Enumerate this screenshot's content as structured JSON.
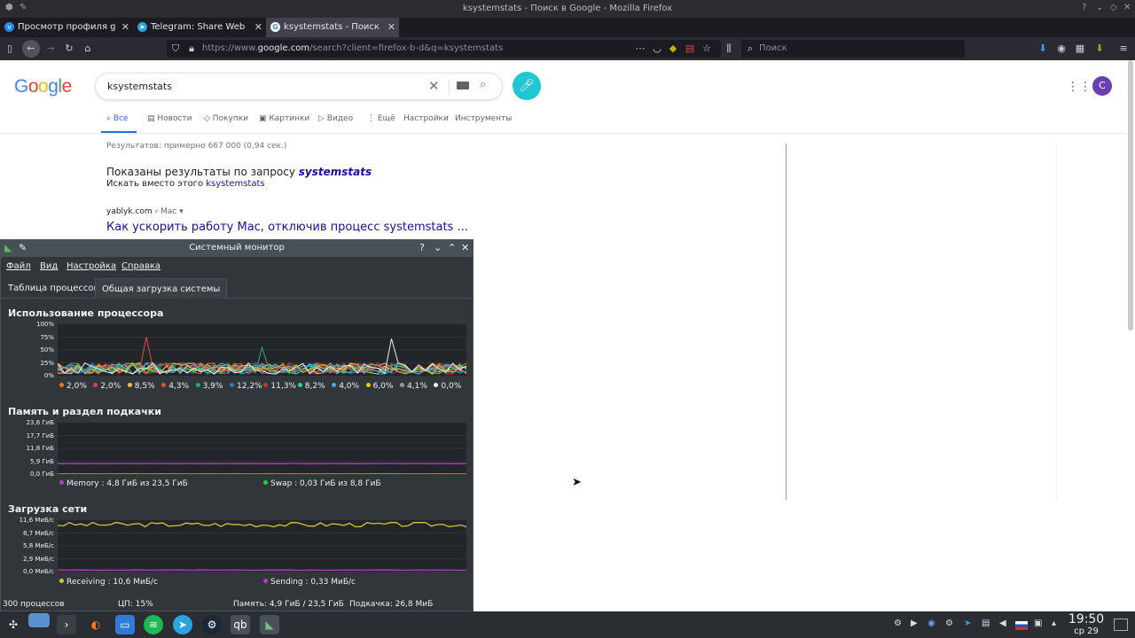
{
  "firefox": {
    "window_title": "ksystemstats - Поиск в Google - Mozilla Firefox",
    "tabs": [
      {
        "label": "Просмотр профиля garik",
        "icon": "vk-icon"
      },
      {
        "label": "Telegram: Share Web Page",
        "icon": "telegram-icon"
      },
      {
        "label": "ksystemstats - Поиск в Go",
        "icon": "google-icon"
      }
    ],
    "url_prefix": "https://www.",
    "url_domain": "google.com",
    "url_rest": "/search?client=firefox-b-d&q=ksystemstats",
    "search_placeholder": "Поиск"
  },
  "google": {
    "logo": "Google",
    "query": "ksystemstats",
    "tabs": [
      "Все",
      "Новости",
      "Покупки",
      "Картинки",
      "Видео",
      "Ещё",
      "Настройки",
      "Инструменты"
    ],
    "avatar_letter": "C",
    "stats": "Результатов: примерно 667 000 (0,94 сек.)",
    "shown_prefix": "Показаны результаты по запросу",
    "shown_term": "systemstats",
    "instead_prefix": "Искать вместо этого",
    "instead_term": "ksystemstats",
    "result": {
      "site": "yablyk.com",
      "crumb": "› Mac",
      "title": "Как ускорить работу Mac, отключив процесс systemstats ..."
    }
  },
  "sysmon": {
    "title": "Системный монитор",
    "menu": [
      "Файл",
      "Вид",
      "Настройка",
      "Справка"
    ],
    "tabs": [
      "Таблица процессов",
      "Общая загрузка системы"
    ],
    "cpu": {
      "title": "Использование процессора",
      "y_labels": [
        "100%",
        "75%",
        "50%",
        "25%",
        "0%"
      ],
      "legend": [
        {
          "value": "2,0%",
          "color": "#f67400"
        },
        {
          "value": "2,0%",
          "color": "#da4453"
        },
        {
          "value": "8,5%",
          "color": "#fdbc4b"
        },
        {
          "value": "4,3%",
          "color": "#e74c3c"
        },
        {
          "value": "3,9%",
          "color": "#27ae60"
        },
        {
          "value": "12,2%",
          "color": "#2980b9"
        },
        {
          "value": "11,3%",
          "color": "#c0392b"
        },
        {
          "value": "8,2%",
          "color": "#1cdc9a"
        },
        {
          "value": "4,0%",
          "color": "#3daee9"
        },
        {
          "value": "6,0%",
          "color": "#f1c40f"
        },
        {
          "value": "4,1%",
          "color": "#8e9da6"
        },
        {
          "value": "0,0%",
          "color": "#eff0f1"
        }
      ]
    },
    "memory": {
      "title": "Память и раздел подкачки",
      "y_labels": [
        "23,6 ГиБ",
        "17,7 ГиБ",
        "11,8 ГиБ",
        "5,9 ГиБ",
        "0,0 ГиБ"
      ],
      "legend": [
        {
          "text": "Memory : 4,8 ГиБ из 23,5 ГиБ",
          "color": "#b43cc8",
          "level": 0.204
        },
        {
          "text": "Swap : 0,03 ГиБ из 8,8 ГиБ",
          "color": "#2ecc40",
          "level": 0.003
        }
      ]
    },
    "network": {
      "title": "Загрузка сети",
      "y_labels": [
        "11,6 МиБ/с",
        "8,7 МиБ/с",
        "5,8 МиБ/с",
        "2,9 МиБ/с",
        "0,0 МиБ/с"
      ],
      "legend": [
        {
          "text": "Receiving : 10,6 МиБ/с",
          "color": "#d4c43a",
          "level": 0.914
        },
        {
          "text": "Sending : 0,33 МиБ/с",
          "color": "#b43cc8",
          "level": 0.028
        }
      ]
    },
    "status": {
      "processes": "300 процессов",
      "cpu": "ЦП: 15%",
      "memory": "Память: 4,9 ГиБ / 23,5 ГиБ",
      "swap": "Подкачка: 26,8 МиБ"
    }
  },
  "panel": {
    "time": "19:50",
    "date": "ср 29"
  }
}
